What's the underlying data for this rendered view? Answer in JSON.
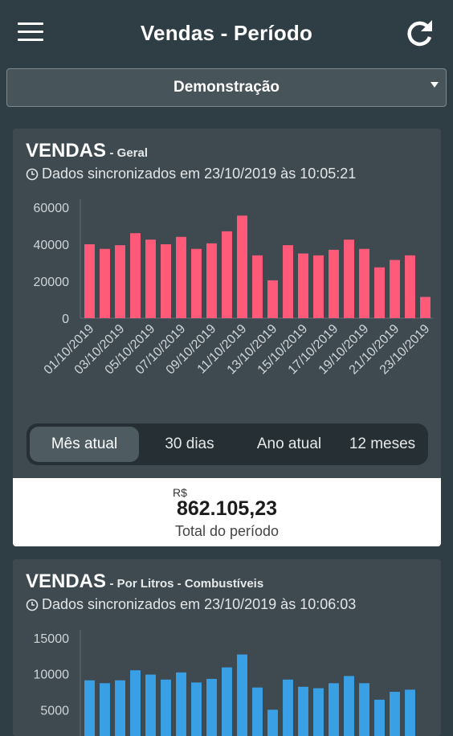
{
  "header": {
    "title": "Vendas - Período",
    "menu_icon": "menu-icon",
    "refresh_icon": "refresh-icon"
  },
  "selector": {
    "value": "Demonstração"
  },
  "card1": {
    "title": "VENDAS",
    "subtitle": "- Geral",
    "sync_text": "Dados sincronizados em 23/10/2019 às 10:05:21",
    "chart_data": {
      "type": "bar",
      "color": "#ff5a7a",
      "ylim": [
        0,
        60000
      ],
      "yticks": [
        "60000",
        "40000",
        "20000",
        "0"
      ],
      "categories": [
        "01/10/2019",
        "02/10/2019",
        "03/10/2019",
        "04/10/2019",
        "05/10/2019",
        "06/10/2019",
        "07/10/2019",
        "08/10/2019",
        "09/10/2019",
        "10/10/2019",
        "11/10/2019",
        "12/10/2019",
        "13/10/2019",
        "14/10/2019",
        "15/10/2019",
        "16/10/2019",
        "17/10/2019",
        "18/10/2019",
        "19/10/2019",
        "20/10/2019",
        "21/10/2019",
        "22/10/2019",
        "23/10/2019"
      ],
      "xticks": [
        "01/10/2019",
        "03/10/2019",
        "05/10/2019",
        "07/10/2019",
        "09/10/2019",
        "11/10/2019",
        "13/10/2019",
        "15/10/2019",
        "17/10/2019",
        "19/10/2019",
        "21/10/2019",
        "23/10/2019"
      ],
      "values": [
        40000,
        37500,
        39500,
        46000,
        42500,
        40000,
        44000,
        37500,
        40500,
        47000,
        55500,
        34000,
        20500,
        39500,
        35000,
        34000,
        37000,
        42500,
        37500,
        27500,
        31500,
        34000,
        11500
      ]
    },
    "tabs": [
      "Mês atual",
      "30 dias",
      "Ano atual",
      "12 meses"
    ],
    "active_tab": 0,
    "total": {
      "currency": "R$",
      "value": "862.105,23",
      "label": "Total do período"
    }
  },
  "card2": {
    "title": "VENDAS",
    "subtitle": "- Por Litros - Combustíveis",
    "sync_text": "Dados sincronizados em 23/10/2019 às 10:06:03",
    "chart_data": {
      "type": "bar",
      "color": "#3aa0e6",
      "ylim": [
        0,
        15000
      ],
      "yticks": [
        "15000",
        "10000",
        "5000"
      ],
      "values": [
        9100,
        8700,
        9100,
        10500,
        9900,
        9200,
        10200,
        8800,
        9300,
        10900,
        12700,
        8100,
        5000,
        9200,
        8200,
        8000,
        8700,
        9700,
        8700,
        6400,
        7500,
        7800
      ]
    }
  }
}
